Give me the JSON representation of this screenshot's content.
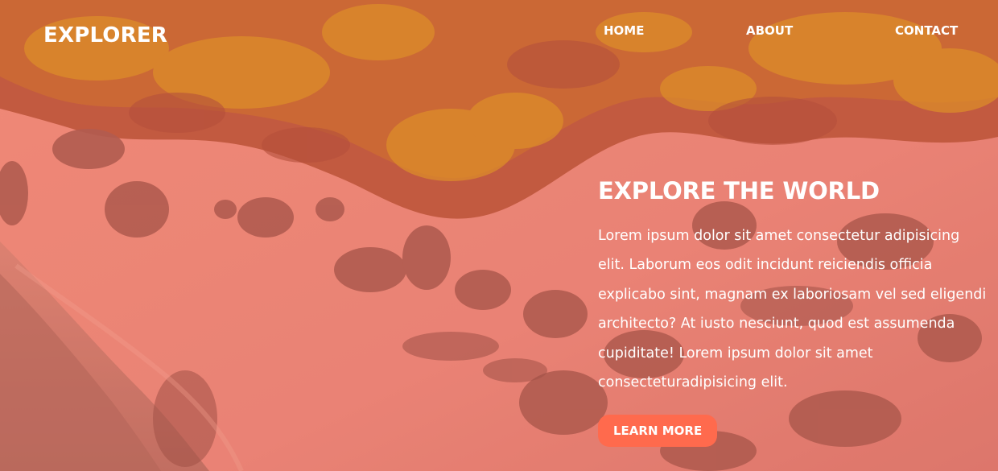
{
  "brand": {
    "logo_text": "EXPLORER"
  },
  "nav": {
    "items": [
      {
        "label": "HOME"
      },
      {
        "label": "ABOUT"
      },
      {
        "label": "CONTACT"
      }
    ]
  },
  "hero": {
    "headline": "EXPLORE THE WORLD",
    "body": "Lorem ipsum dolor sit amet consectetur adipisicing elit. Laborum eos odit incidunt reiciendis officia explicabo sint, magnam ex laboriosam vel sed eligendi architecto? At iusto nesciunt, quod est assumenda cupiditate! Lorem ipsum dolor sit amet consecteturadipisicing elit.",
    "cta_label": "LEARN MORE",
    "background_image": "aerial beach coastline"
  },
  "colors": {
    "overlay": "#e78a78",
    "accent_button": "#ff6a4d",
    "text": "#ffffff"
  }
}
